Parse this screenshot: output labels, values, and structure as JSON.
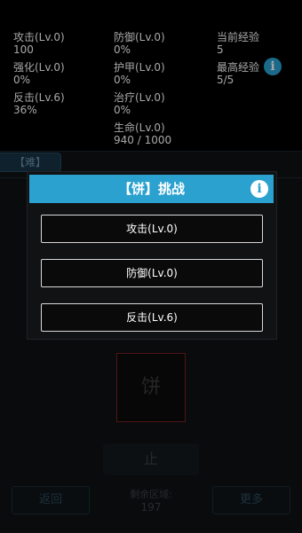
{
  "stats": {
    "attack": {
      "label": "攻击(Lv.0)",
      "value": "100"
    },
    "defense": {
      "label": "防御(Lv.0)",
      "value": "0%"
    },
    "current_exp": {
      "label": "当前经验",
      "value": "5"
    },
    "enhance": {
      "label": "强化(Lv.0)",
      "value": "0%"
    },
    "armor": {
      "label": "护甲(Lv.0)",
      "value": "0%"
    },
    "max_exp": {
      "label": "最高经验",
      "value": "5/5"
    },
    "counter": {
      "label": "反击(Lv.6)",
      "value": "36%"
    },
    "heal": {
      "label": "治疗(Lv.0)",
      "value": "0%"
    },
    "life": {
      "label": "生命(Lv.0)",
      "value": "940 / 1000"
    },
    "info_icon": "i"
  },
  "difficulty_label": "【难】",
  "tile_char": "饼",
  "stop_label": "止",
  "back_label": "返回",
  "more_label": "更多",
  "remaining": {
    "label": "剩余区域:",
    "value": "197"
  },
  "modal": {
    "title": "【饼】挑战",
    "info_icon": "i",
    "choices": [
      "攻击(Lv.0)",
      "防御(Lv.0)",
      "反击(Lv.6)"
    ]
  },
  "colors": {
    "accent": "#2aa1cf",
    "info_icon": "#29a3d6",
    "tile_border": "#7a1f26"
  }
}
